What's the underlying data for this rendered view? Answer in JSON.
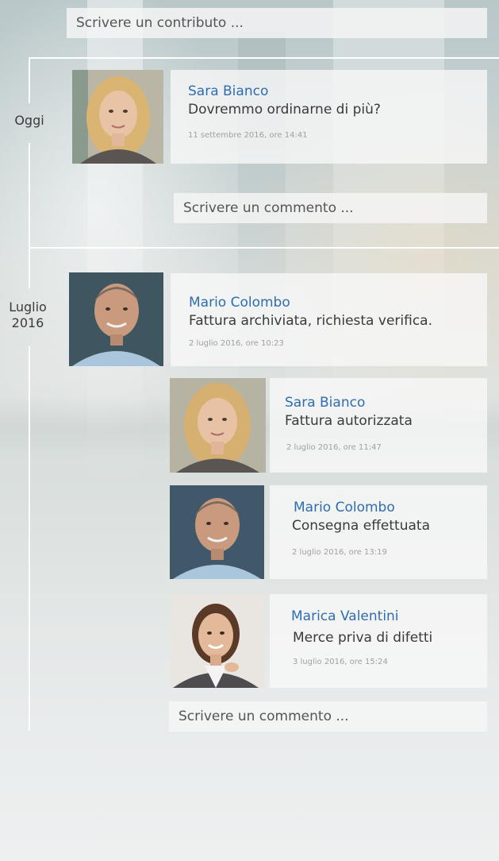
{
  "composer": {
    "placeholder": "Scrivere un contributo ..."
  },
  "sections": [
    {
      "label_lines": [
        "Oggi"
      ],
      "posts": [
        {
          "author": "Sara Bianco",
          "message": "Dovremmo ordinarne di più?",
          "timestamp": "11  settembre 2016, ore 14:41"
        }
      ],
      "comment_placeholder": "Scrivere un commento ..."
    },
    {
      "label_lines": [
        "Luglio",
        "2016"
      ],
      "posts": [
        {
          "author": "Mario Colombo",
          "message": "Fattura archiviata, richiesta verifica.",
          "timestamp": "2 luglio 2016, ore 10:23"
        }
      ],
      "replies": [
        {
          "author": "Sara Bianco",
          "message": "Fattura autorizzata",
          "timestamp": "2 luglio 2016, ore 11:47"
        },
        {
          "author": "Mario Colombo",
          "message": "Consegna effettuata",
          "timestamp": "2 luglio 2016, ore 13:19"
        },
        {
          "author": "Marica Valentini",
          "message": "Merce priva di difetti",
          "timestamp": "3 luglio 2016, ore 15:24"
        }
      ],
      "comment_placeholder": "Scrivere un commento ..."
    }
  ]
}
